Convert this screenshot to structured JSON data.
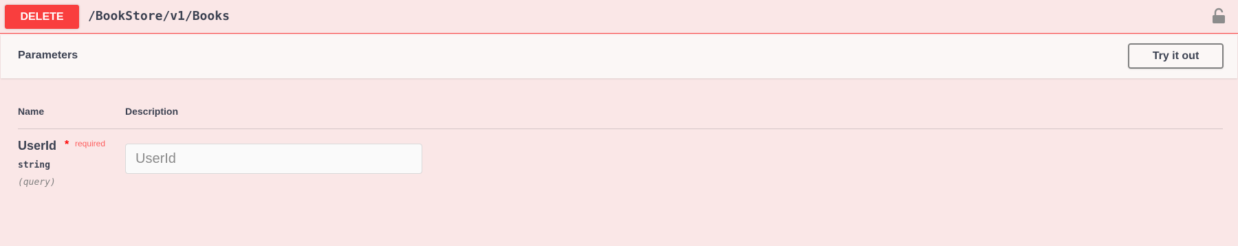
{
  "operation": {
    "method": "DELETE",
    "path": "/BookStore/v1/Books",
    "colors": {
      "method_bg": "#f93e3e",
      "block_bg": "#fae7e7",
      "border": "#f93e3e"
    },
    "lock_icon": "lock-open-icon"
  },
  "parameters_section": {
    "title": "Parameters",
    "try_button_label": "Try it out",
    "columns": {
      "name": "Name",
      "description": "Description"
    },
    "params": [
      {
        "name": "UserId",
        "required_star": "*",
        "required_label": "required",
        "type": "string",
        "location": "(query)",
        "placeholder": "UserId",
        "value": ""
      }
    ]
  }
}
